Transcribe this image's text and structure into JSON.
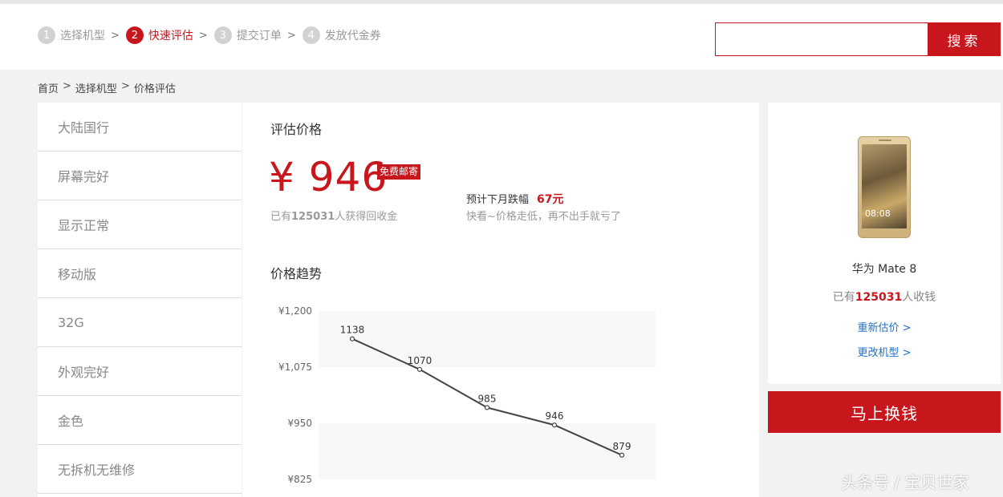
{
  "colors": {
    "accent": "#c8161d",
    "link": "#1f6fc5",
    "muted": "#999999"
  },
  "steps": [
    {
      "num": "1",
      "label": "选择机型",
      "active": false
    },
    {
      "num": "2",
      "label": "快速评估",
      "active": true
    },
    {
      "num": "3",
      "label": "提交订单",
      "active": false
    },
    {
      "num": "4",
      "label": "发放代金券",
      "active": false
    }
  ],
  "step_sep": ">",
  "search": {
    "value": "",
    "button": "搜索"
  },
  "breadcrumb": {
    "items": [
      "首页",
      "选择机型",
      "价格评估"
    ],
    "sep": ">"
  },
  "attributes": [
    "大陆国行",
    "屏幕完好",
    "显示正常",
    "移动版",
    "32G",
    "外观完好",
    "金色",
    "无拆机无维修"
  ],
  "evaluation": {
    "title": "评估价格",
    "price": "¥ 946",
    "badge": "免费邮寄",
    "owners_prefix": "已有",
    "owners_count": "125031",
    "owners_suffix": "人获得回收金",
    "forecast_label": "预计下月跌幅",
    "forecast_amount": "67元",
    "forecast_note": "快看~价格走低，再不出手就亏了"
  },
  "trend_title": "价格趋势",
  "chart_data": {
    "type": "line",
    "y_tick_labels": [
      "¥1,200",
      "¥1,075",
      "¥950",
      "¥825"
    ],
    "y_ticks": [
      1200,
      1075,
      950,
      825
    ],
    "ylim": [
      825,
      1200
    ],
    "series": [
      {
        "values": [
          1138,
          1070,
          985,
          946,
          879
        ]
      }
    ],
    "data_labels": [
      "1138",
      "1070",
      "985",
      "946",
      "879"
    ],
    "grid": "banded",
    "color": "#444444"
  },
  "product": {
    "phone_time": "08:08",
    "name": "华为 Mate 8",
    "owners_prefix": "已有",
    "owners_count": "125031",
    "owners_suffix": "人收钱",
    "reestimate": "重新估价 >",
    "change_model": "更改机型 >"
  },
  "cash_button": "马上换钱",
  "watermark": "头条号 / 宝贝世家"
}
